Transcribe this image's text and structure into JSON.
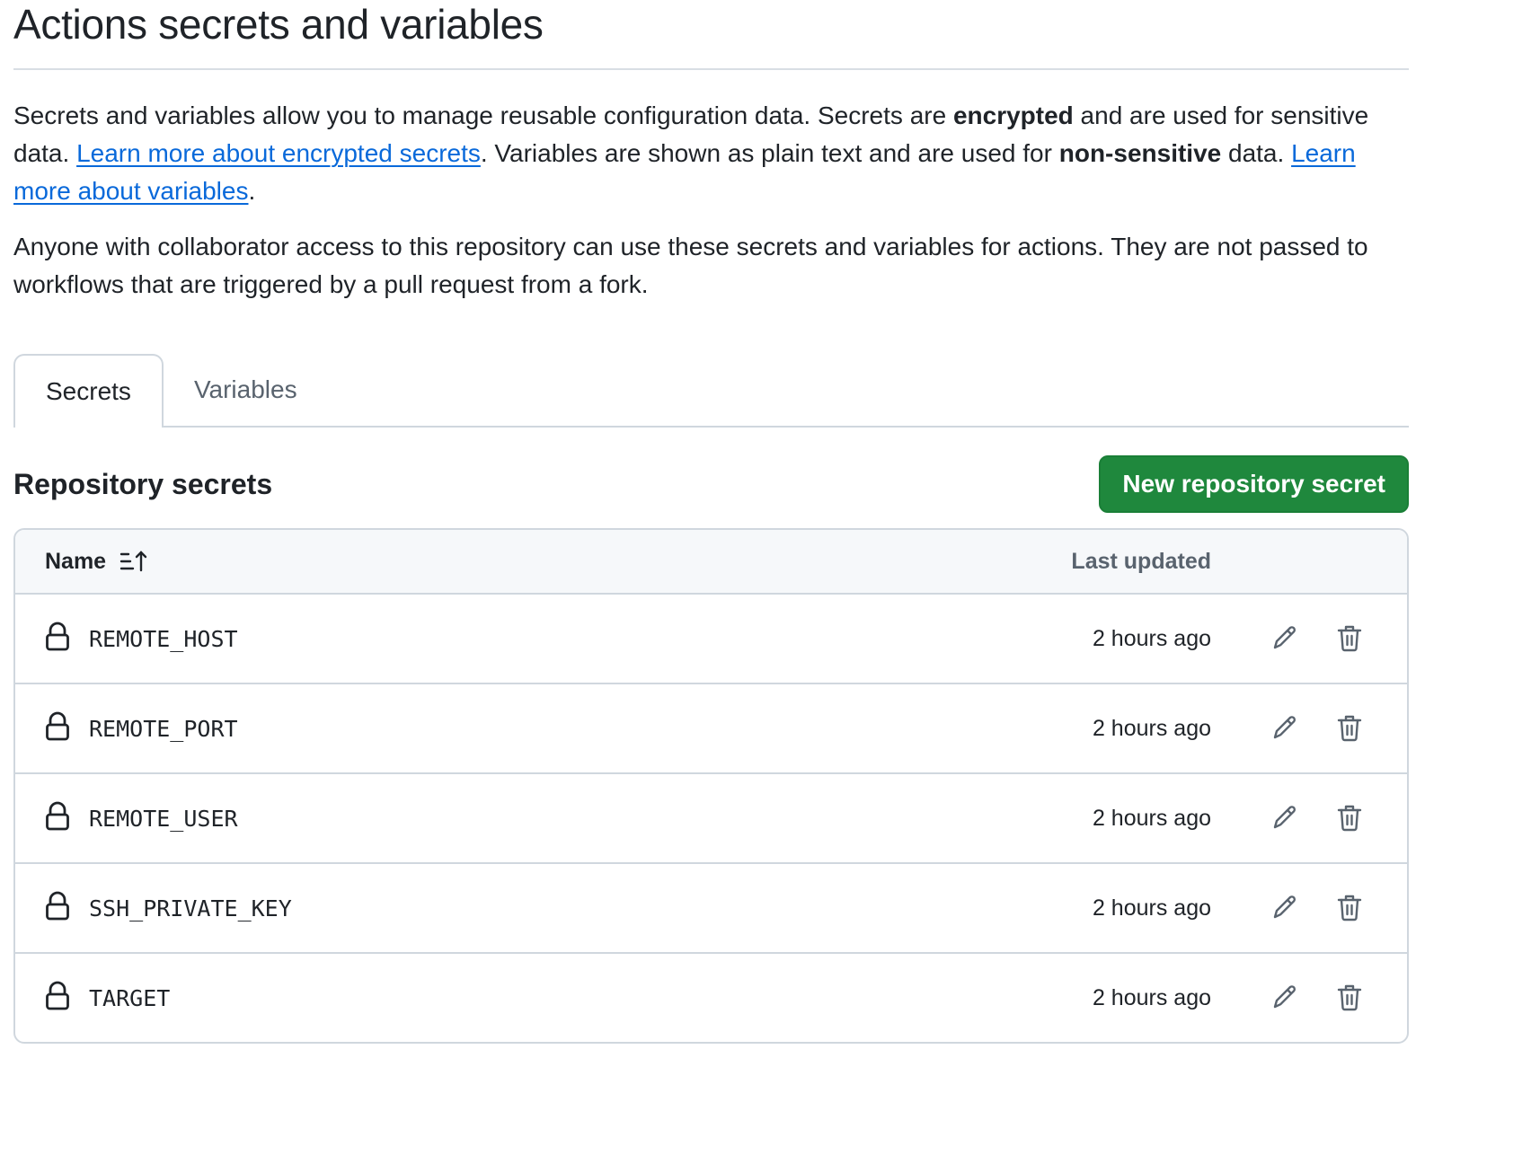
{
  "header": {
    "title": "Actions secrets and variables"
  },
  "description": {
    "p1_part1": "Secrets and variables allow you to manage reusable configuration data. Secrets are ",
    "p1_bold1": "encrypted",
    "p1_part2": " and are used for sensitive data. ",
    "p1_link1": "Learn more about encrypted secrets",
    "p1_part3": ". Variables are shown as plain text and are used for ",
    "p1_bold2": "non-sensitive",
    "p1_part4": " data. ",
    "p1_link2": "Learn more about variables",
    "p1_part5": ".",
    "p2": "Anyone with collaborator access to this repository can use these secrets and variables for actions. They are not passed to workflows that are triggered by a pull request from a fork."
  },
  "tabs": [
    {
      "label": "Secrets",
      "active": true
    },
    {
      "label": "Variables",
      "active": false
    }
  ],
  "section": {
    "title": "Repository secrets",
    "new_button_label": "New repository secret"
  },
  "table": {
    "columns": {
      "name": "Name",
      "last_updated": "Last updated"
    },
    "rows": [
      {
        "name": "REMOTE_HOST",
        "updated": "2 hours ago"
      },
      {
        "name": "REMOTE_PORT",
        "updated": "2 hours ago"
      },
      {
        "name": "REMOTE_USER",
        "updated": "2 hours ago"
      },
      {
        "name": "SSH_PRIVATE_KEY",
        "updated": "2 hours ago"
      },
      {
        "name": "TARGET",
        "updated": "2 hours ago"
      }
    ]
  },
  "icons": {
    "sort": "sort-ascending-icon",
    "lock": "lock-icon",
    "edit": "pencil-icon",
    "delete": "trash-icon"
  },
  "colors": {
    "primary_button": "#1f883d",
    "link": "#0969da",
    "border": "#d0d7de",
    "header_bg": "#f6f8fa",
    "muted_text": "#59636e"
  }
}
